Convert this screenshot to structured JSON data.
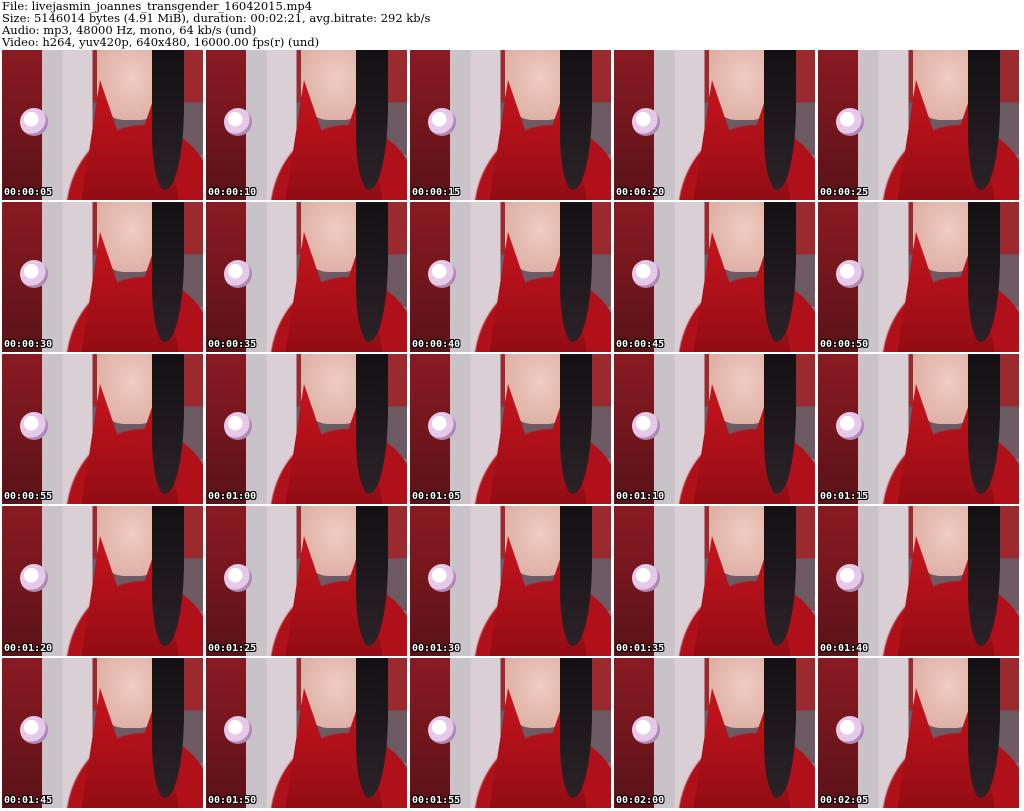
{
  "header": {
    "line1": "File: livejasmin_joannes_transgender_16042015.mp4",
    "line2": "Size: 5146014 bytes (4.91 MiB), duration: 00:02:21, avg.bitrate: 292 kb/s",
    "line3": "Audio: mp3, 48000 Hz, mono, 64 kb/s (und)",
    "line4": "Video: h264, yuv420p, 640x480, 16000.00 fps(r) (und)"
  },
  "thumbnails": [
    {
      "timestamp": "00:00:05"
    },
    {
      "timestamp": "00:00:10"
    },
    {
      "timestamp": "00:00:15"
    },
    {
      "timestamp": "00:00:20"
    },
    {
      "timestamp": "00:00:25"
    },
    {
      "timestamp": "00:00:30"
    },
    {
      "timestamp": "00:00:35"
    },
    {
      "timestamp": "00:00:40"
    },
    {
      "timestamp": "00:00:45"
    },
    {
      "timestamp": "00:00:50"
    },
    {
      "timestamp": "00:00:55"
    },
    {
      "timestamp": "00:01:00"
    },
    {
      "timestamp": "00:01:05"
    },
    {
      "timestamp": "00:01:10"
    },
    {
      "timestamp": "00:01:15"
    },
    {
      "timestamp": "00:01:20"
    },
    {
      "timestamp": "00:01:25"
    },
    {
      "timestamp": "00:01:30"
    },
    {
      "timestamp": "00:01:35"
    },
    {
      "timestamp": "00:01:40"
    },
    {
      "timestamp": "00:01:45"
    },
    {
      "timestamp": "00:01:50"
    },
    {
      "timestamp": "00:01:55"
    },
    {
      "timestamp": "00:02:00"
    },
    {
      "timestamp": "00:02:05"
    }
  ]
}
